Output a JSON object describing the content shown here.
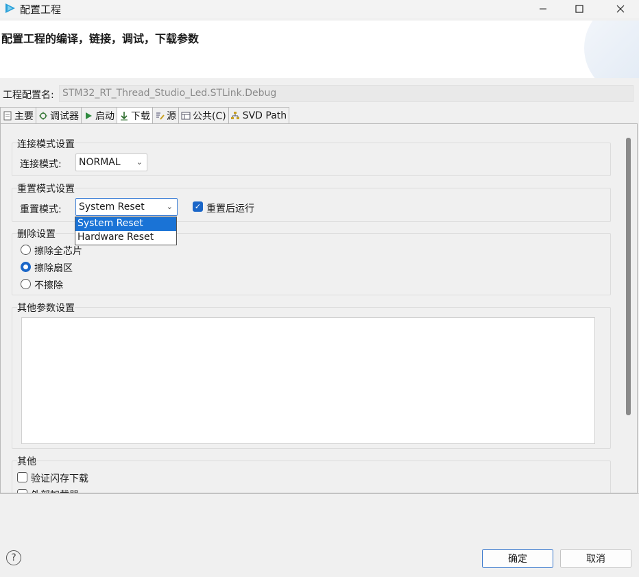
{
  "window": {
    "title": "配置工程",
    "minimize_icon": "minimize-icon",
    "maximize_icon": "maximize-icon",
    "close_icon": "close-icon"
  },
  "banner": {
    "title": "配置工程的编译，链接，调试，下载参数"
  },
  "config": {
    "label": "工程配置名:",
    "value": "STM32_RT_Thread_Studio_Led.STLink.Debug"
  },
  "tabs": [
    {
      "label": "主要",
      "icon": "document-icon"
    },
    {
      "label": "调试器",
      "icon": "debugger-icon"
    },
    {
      "label": "启动",
      "icon": "play-icon"
    },
    {
      "label": "下载",
      "icon": "download-icon",
      "active": true
    },
    {
      "label": "源",
      "icon": "source-icon"
    },
    {
      "label": "公共(C)",
      "icon": "common-icon"
    },
    {
      "label": "SVD Path",
      "icon": "tree-icon"
    }
  ],
  "connect_group": {
    "title": "连接模式设置",
    "mode_label": "连接模式:",
    "mode_value": "NORMAL"
  },
  "reset_group": {
    "title": "重置模式设置",
    "mode_label": "重置模式:",
    "mode_value": "System Reset",
    "run_after_reset_label": "重置后运行",
    "run_after_reset_checked": true,
    "options": [
      "System Reset",
      "Hardware Reset"
    ]
  },
  "erase_group": {
    "title": "删除设置",
    "options": [
      {
        "label": "擦除全芯片",
        "checked": false
      },
      {
        "label": "擦除扇区",
        "checked": true
      },
      {
        "label": "不擦除",
        "checked": false
      }
    ]
  },
  "other_params": {
    "title": "其他参数设置",
    "value": ""
  },
  "misc_group": {
    "title": "其他",
    "verify_flash_label": "验证闪存下载",
    "verify_flash_checked": false,
    "external_loader_label": "外部加载器"
  },
  "footer": {
    "ok_label": "确定",
    "cancel_label": "取消",
    "help_icon": "help-icon"
  },
  "colors": {
    "accent": "#1a73d6",
    "check": "#1a66c8"
  }
}
